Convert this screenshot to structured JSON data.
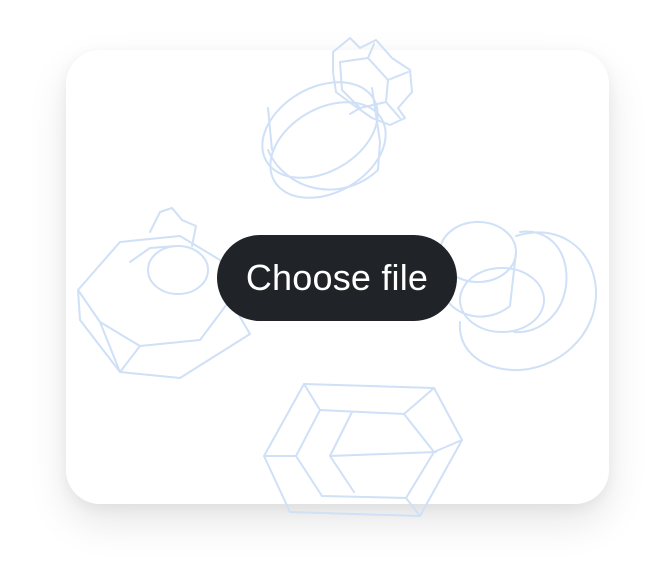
{
  "upload": {
    "button_label": "Choose file"
  },
  "colors": {
    "button_bg": "#202428",
    "button_text": "#ffffff",
    "illustration_stroke": "#cfe0f7",
    "card_bg": "#ffffff"
  },
  "illustrations": [
    {
      "name": "gear-cylinder-icon"
    },
    {
      "name": "hex-nut-icon"
    },
    {
      "name": "cylinder-icon"
    },
    {
      "name": "box-icon"
    }
  ]
}
